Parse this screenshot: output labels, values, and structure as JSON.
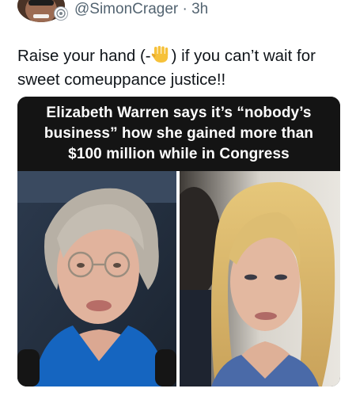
{
  "post": {
    "handle": "@SimonCrager",
    "separator": " · ",
    "time": "3h",
    "text_before_emoji": "Raise your hand (-",
    "emoji": "raised-hand-emoji",
    "text_after_emoji": ") if you can’t wait for sweet comeuppance justice!!"
  },
  "media": {
    "caption_lines": [
      "Elizabeth Warren says it’s “nobody’s",
      "business” how she gained more than",
      "$100 million while in Congress"
    ]
  },
  "colors": {
    "text": "#0f1419",
    "muted": "#536471",
    "caption_bg": "#141414",
    "emoji": "#f6c13a"
  }
}
